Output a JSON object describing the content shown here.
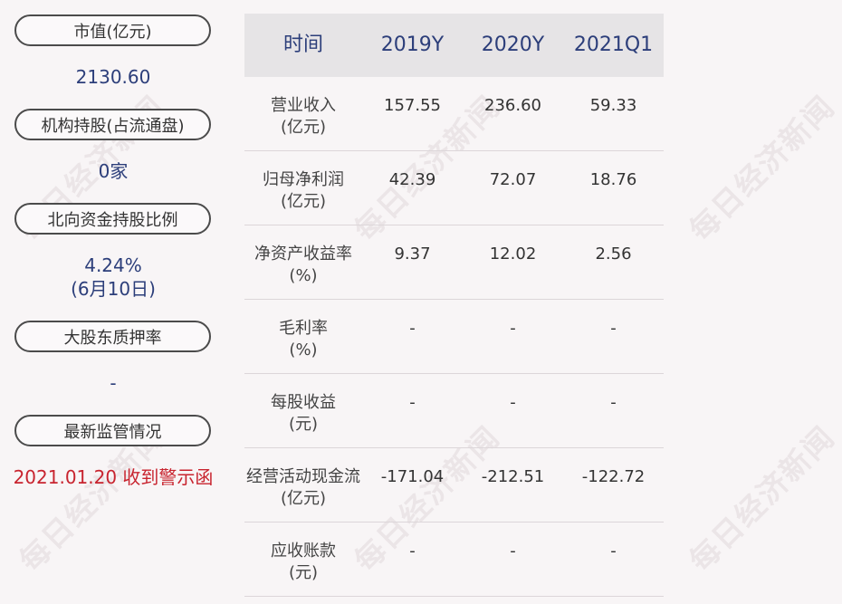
{
  "left_panel": {
    "market_cap_label": "市值(亿元)",
    "market_cap_value": "2130.60",
    "inst_holding_label": "机构持股(占流通盘)",
    "inst_holding_value": "0家",
    "northbound_label": "北向资金持股比例",
    "northbound_value": "4.24%",
    "northbound_date": "(6月10日)",
    "pledge_label": "大股东质押率",
    "pledge_value": "-",
    "regulation_label": "最新监管情况",
    "regulation_value": "2021.01.20 收到警示函"
  },
  "table": {
    "headers": [
      "时间",
      "2019Y",
      "2020Y",
      "2021Q1"
    ],
    "rows": [
      {
        "label": "营业收入",
        "unit": "(亿元)",
        "values": [
          "157.55",
          "236.60",
          "59.33"
        ]
      },
      {
        "label": "归母净利润",
        "unit": "(亿元)",
        "values": [
          "42.39",
          "72.07",
          "18.76"
        ]
      },
      {
        "label": "净资产收益率",
        "unit": "(%)",
        "values": [
          "9.37",
          "12.02",
          "2.56"
        ]
      },
      {
        "label": "毛利率",
        "unit": "(%)",
        "values": [
          "-",
          "-",
          "-"
        ]
      },
      {
        "label": "每股收益",
        "unit": "(元)",
        "values": [
          "-",
          "-",
          "-"
        ]
      },
      {
        "label": "经营活动现金流",
        "unit": "(亿元)",
        "values": [
          "-171.04",
          "-212.51",
          "-122.72"
        ]
      },
      {
        "label": "应收账款",
        "unit": "(元)",
        "values": [
          "-",
          "-",
          "-"
        ]
      }
    ]
  },
  "watermark_text": "每日经济新闻"
}
